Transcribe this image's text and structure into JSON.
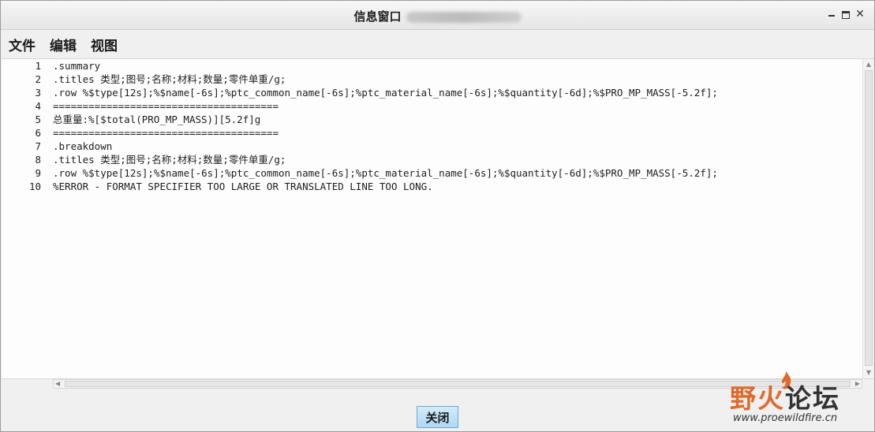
{
  "window": {
    "title": "信息窗口",
    "controls": [
      "minimize-icon",
      "maximize-icon",
      "close-icon"
    ]
  },
  "menu": {
    "items": [
      {
        "label": "文件"
      },
      {
        "label": "编辑"
      },
      {
        "label": "视图"
      }
    ]
  },
  "editor": {
    "lines": [
      {
        "num": "1",
        "text": ".summary"
      },
      {
        "num": "2",
        "text": ".titles 类型;图号;名称;材料;数量;零件单重/g;"
      },
      {
        "num": "3",
        "text": ".row %$type[12s];%$name[-6s];%ptc_common_name[-6s];%ptc_material_name[-6s];%$quantity[-6d];%$PRO_MP_MASS[-5.2f];"
      },
      {
        "num": "4",
        "text": "======================================"
      },
      {
        "num": "5",
        "text": "总重量:%[$total(PRO_MP_MASS)][5.2f]g"
      },
      {
        "num": "6",
        "text": "======================================"
      },
      {
        "num": "7",
        "text": ".breakdown"
      },
      {
        "num": "8",
        "text": ".titles 类型;图号;名称;材料;数量;零件单重/g;"
      },
      {
        "num": "9",
        "text": ".row %$type[12s];%$name[-6s];%ptc_common_name[-6s];%ptc_material_name[-6s];%$quantity[-6d];%$PRO_MP_MASS[-5.2f];"
      },
      {
        "num": "10",
        "text": "%ERROR - FORMAT SPECIFIER TOO LARGE OR TRANSLATED LINE TOO LONG."
      }
    ]
  },
  "footer": {
    "close_label": "关闭"
  },
  "watermark": {
    "title_part1": "野火",
    "title_part2": "论坛",
    "url": "www.proewildfire.cn"
  },
  "colors": {
    "button_bg": "#bfe1f6",
    "button_border": "#6aaad6",
    "watermark_accent": "#e06a2c"
  }
}
